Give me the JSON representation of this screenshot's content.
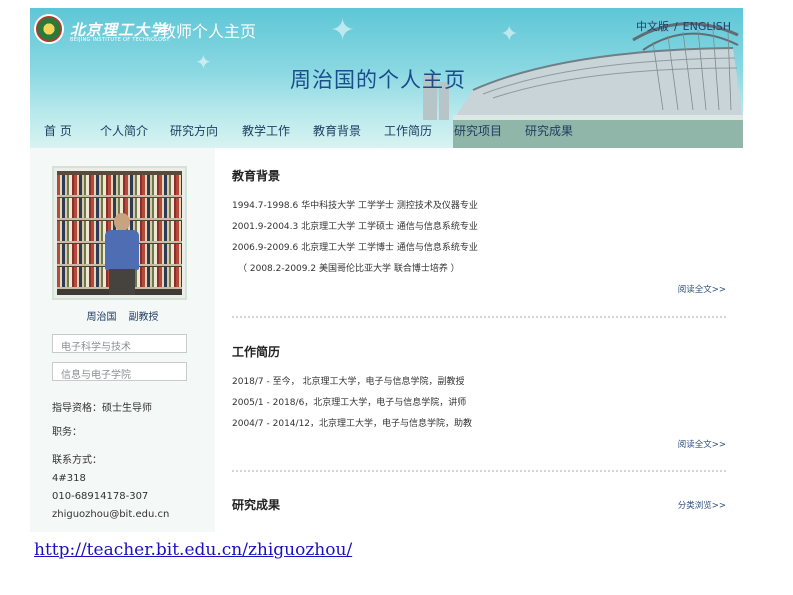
{
  "header": {
    "school_name": "北京理工大学",
    "school_sub": "BEIJING INSTITUTE OF TECHNOLOGY",
    "site_title": "教师个人主页",
    "page_heading": "周治国的个人主页",
    "lang_cn": "中文版",
    "lang_sep": "/",
    "lang_en": "ENGLISH"
  },
  "nav": [
    {
      "label": "首 页"
    },
    {
      "label": "个人简介"
    },
    {
      "label": "研究方向"
    },
    {
      "label": "教学工作"
    },
    {
      "label": "教育背景"
    },
    {
      "label": "工作简历"
    },
    {
      "label": "研究项目"
    },
    {
      "label": "研究成果"
    }
  ],
  "sidebar": {
    "name": "周治国",
    "rank": "副教授",
    "discipline": "电子科学与技术",
    "school": "信息与电子学院",
    "advisor": "指导资格：硕士生导师",
    "duty": "职务：",
    "contact_label": "联系方式：",
    "office": "4#318",
    "phone": "010-68914178-307",
    "email": "zhiguozhou@bit.edu.cn"
  },
  "education": {
    "title": "教育背景",
    "rows": [
      "1994.7-1998.6  华中科技大学 工学学士  测控技术及仪器专业",
      "2001.9-2004.3  北京理工大学 工学硕士 通信与信息系统专业",
      "2006.9-2009.6  北京理工大学 工学博士  通信与信息系统专业",
      "（ 2008.2-2009.2  美国哥伦比亚大学 联合博士培养 ）"
    ],
    "more": "阅读全文>>"
  },
  "work": {
    "title": "工作简历",
    "rows": [
      "2018/7 - 至今，   北京理工大学，电子与信息学院，副教授",
      "2005/1 - 2018/6，北京理工大学，电子与信息学院，讲师",
      "2004/7 - 2014/12，北京理工大学，电子与信息学院，助教"
    ],
    "more": "阅读全文>>"
  },
  "research": {
    "title": "研究成果",
    "more": "分类浏览>>"
  },
  "url": "http://teacher.bit.edu.cn/zhiguozhou/"
}
